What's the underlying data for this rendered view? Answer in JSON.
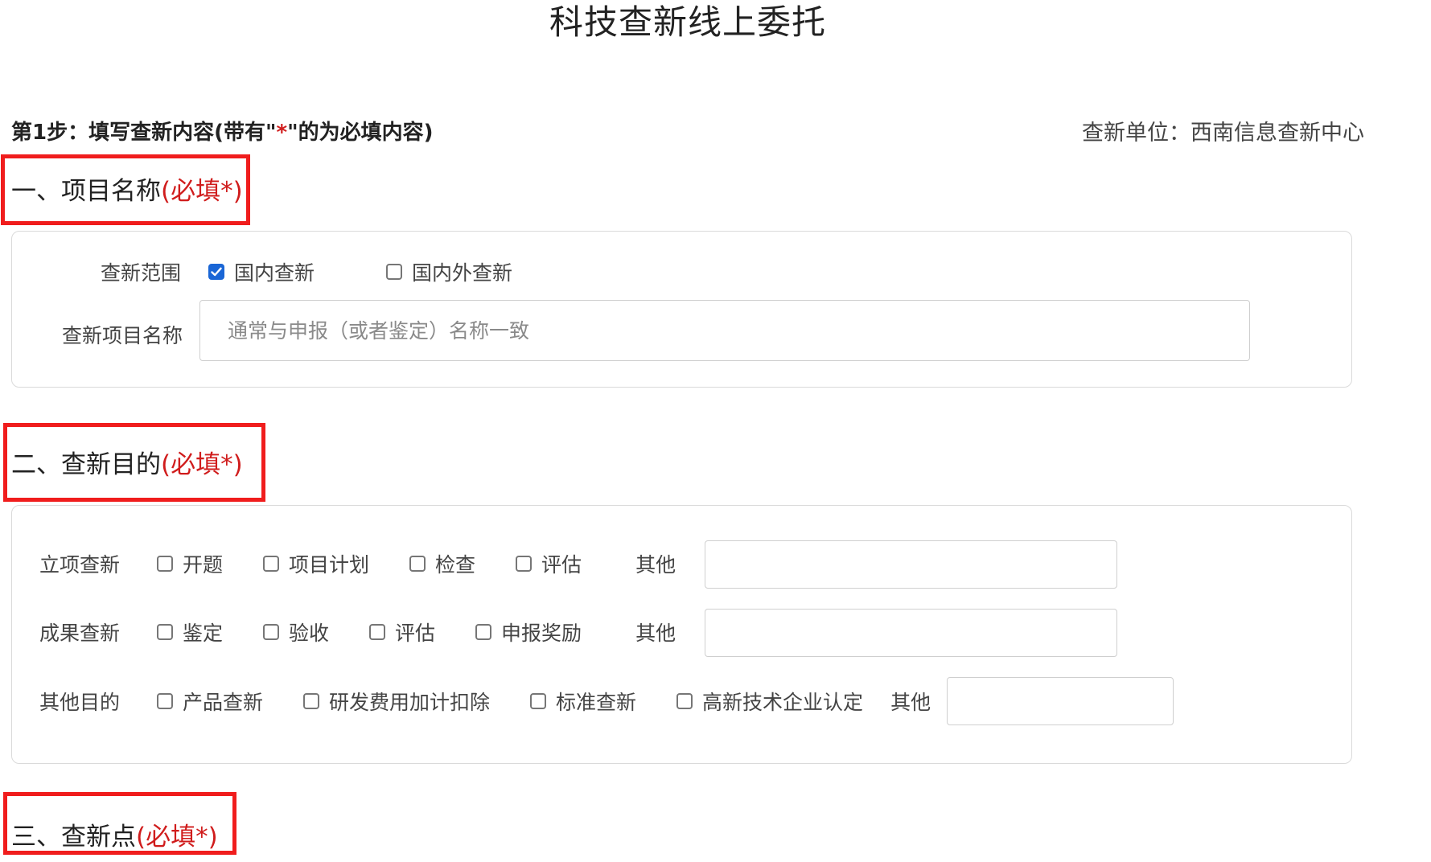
{
  "page": {
    "title": "科技查新线上委托"
  },
  "step": {
    "title_prefix": "第1步：填写查新内容(带有\"",
    "star": "*",
    "title_suffix": "\"的为必填内容)",
    "unit_label": "查新单位：西南信息查新中心"
  },
  "section1": {
    "heading": "一、项目名称",
    "required": "(必填*)",
    "scope_label": "查新范围",
    "scope_options": [
      {
        "label": "国内查新",
        "checked": true
      },
      {
        "label": "国内外查新",
        "checked": false
      }
    ],
    "project_name_label": "查新项目名称",
    "project_name_placeholder": "通常与申报（或者鉴定）名称一致",
    "project_name_value": ""
  },
  "section2": {
    "heading": "二、查新目的",
    "required": "(必填*)",
    "rows": [
      {
        "label": "立项查新",
        "options": [
          {
            "label": "开题",
            "checked": false
          },
          {
            "label": "项目计划",
            "checked": false
          },
          {
            "label": "检查",
            "checked": false
          },
          {
            "label": "评估",
            "checked": false
          }
        ],
        "other_label": "其他",
        "other_value": ""
      },
      {
        "label": "成果查新",
        "options": [
          {
            "label": "鉴定",
            "checked": false
          },
          {
            "label": "验收",
            "checked": false
          },
          {
            "label": "评估",
            "checked": false
          },
          {
            "label": "申报奖励",
            "checked": false
          }
        ],
        "other_label": "其他",
        "other_value": ""
      },
      {
        "label": "其他目的",
        "options": [
          {
            "label": "产品查新",
            "checked": false
          },
          {
            "label": "研发费用加计扣除",
            "checked": false
          },
          {
            "label": "标准查新",
            "checked": false
          },
          {
            "label": "高新技术企业认定",
            "checked": false
          }
        ],
        "other_label": "其他",
        "other_value": ""
      }
    ]
  },
  "section3": {
    "heading": "三、查新点",
    "required": "(必填*)"
  },
  "colors": {
    "required_red": "#d01c1c",
    "highlight_red": "#f01d1d",
    "checkbox_blue": "#1a66d6"
  }
}
